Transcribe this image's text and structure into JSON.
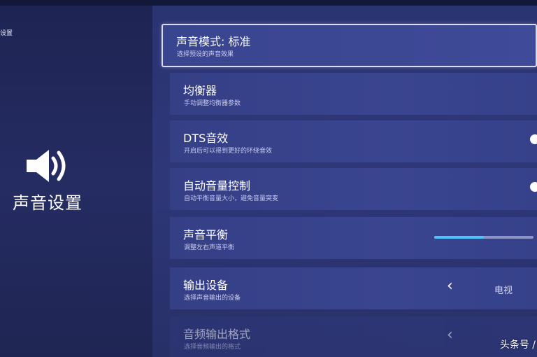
{
  "sidebar": {
    "corner_label": "设置",
    "icon": "speaker-icon",
    "title": "声音设置"
  },
  "items": [
    {
      "title": "声音模式: 标准",
      "subtitle": "选择预设的声音效果",
      "selected": true
    },
    {
      "title": "均衡器",
      "subtitle": "手动调整均衡器参数"
    },
    {
      "title": "DTS音效",
      "subtitle": "开启后可以得到更好的环绕音效",
      "control": "toggle"
    },
    {
      "title": "自动音量控制",
      "subtitle": "自动平衡音量大小，避免音量突变",
      "control": "toggle"
    },
    {
      "title": "声音平衡",
      "subtitle": "调整左右声道平衡",
      "control": "slider",
      "slider_value": 0.5
    },
    {
      "title": "输出设备",
      "subtitle": "选择声音输出的设备",
      "control": "selector",
      "value": "电视"
    },
    {
      "title": "音频输出格式",
      "subtitle": "选择音频输出的格式",
      "control": "selector",
      "faded": true
    }
  ],
  "watermark": "头条号 /",
  "colors": {
    "accent": "#4fc3f7",
    "panel": "#2e3778",
    "item": "#3a4590"
  }
}
